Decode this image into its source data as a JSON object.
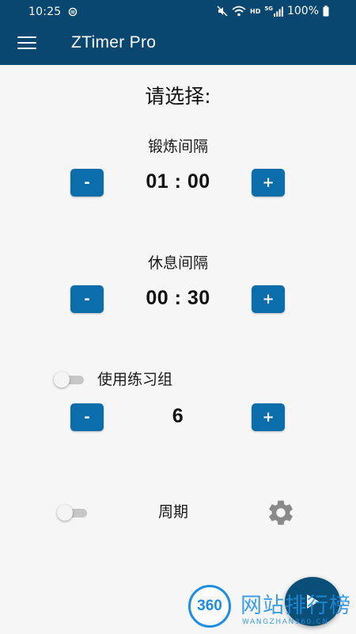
{
  "status_bar": {
    "time": "10:25",
    "network_type": "HD",
    "signal_label": "5G",
    "battery_text": "100%"
  },
  "app_bar": {
    "title": "ZTimer Pro",
    "menu_icon": "hamburger-menu-icon"
  },
  "page": {
    "title": "请选择:"
  },
  "workout_interval": {
    "label": "锻炼间隔",
    "value": "01 : 00",
    "decrement_label": "-",
    "increment_label": "+"
  },
  "rest_interval": {
    "label": "休息间隔",
    "value": "00 : 30",
    "decrement_label": "-",
    "increment_label": "+"
  },
  "sets": {
    "toggle_label": "使用练习组",
    "toggle_on": false,
    "value": "6",
    "decrement_label": "-",
    "increment_label": "+"
  },
  "cycle": {
    "toggle_label": "周期",
    "toggle_on": false,
    "settings_icon": "gear-icon"
  },
  "fab": {
    "icon": "play-icon"
  },
  "watermark": {
    "logo_text": "360",
    "name": "网站排行榜",
    "sub": "WANGZHAN360.CN"
  },
  "colors": {
    "app_bar": "#0a4770",
    "button": "#0b6eaa",
    "background": "#f6f6f6",
    "watermark": "#1e8fe0"
  }
}
